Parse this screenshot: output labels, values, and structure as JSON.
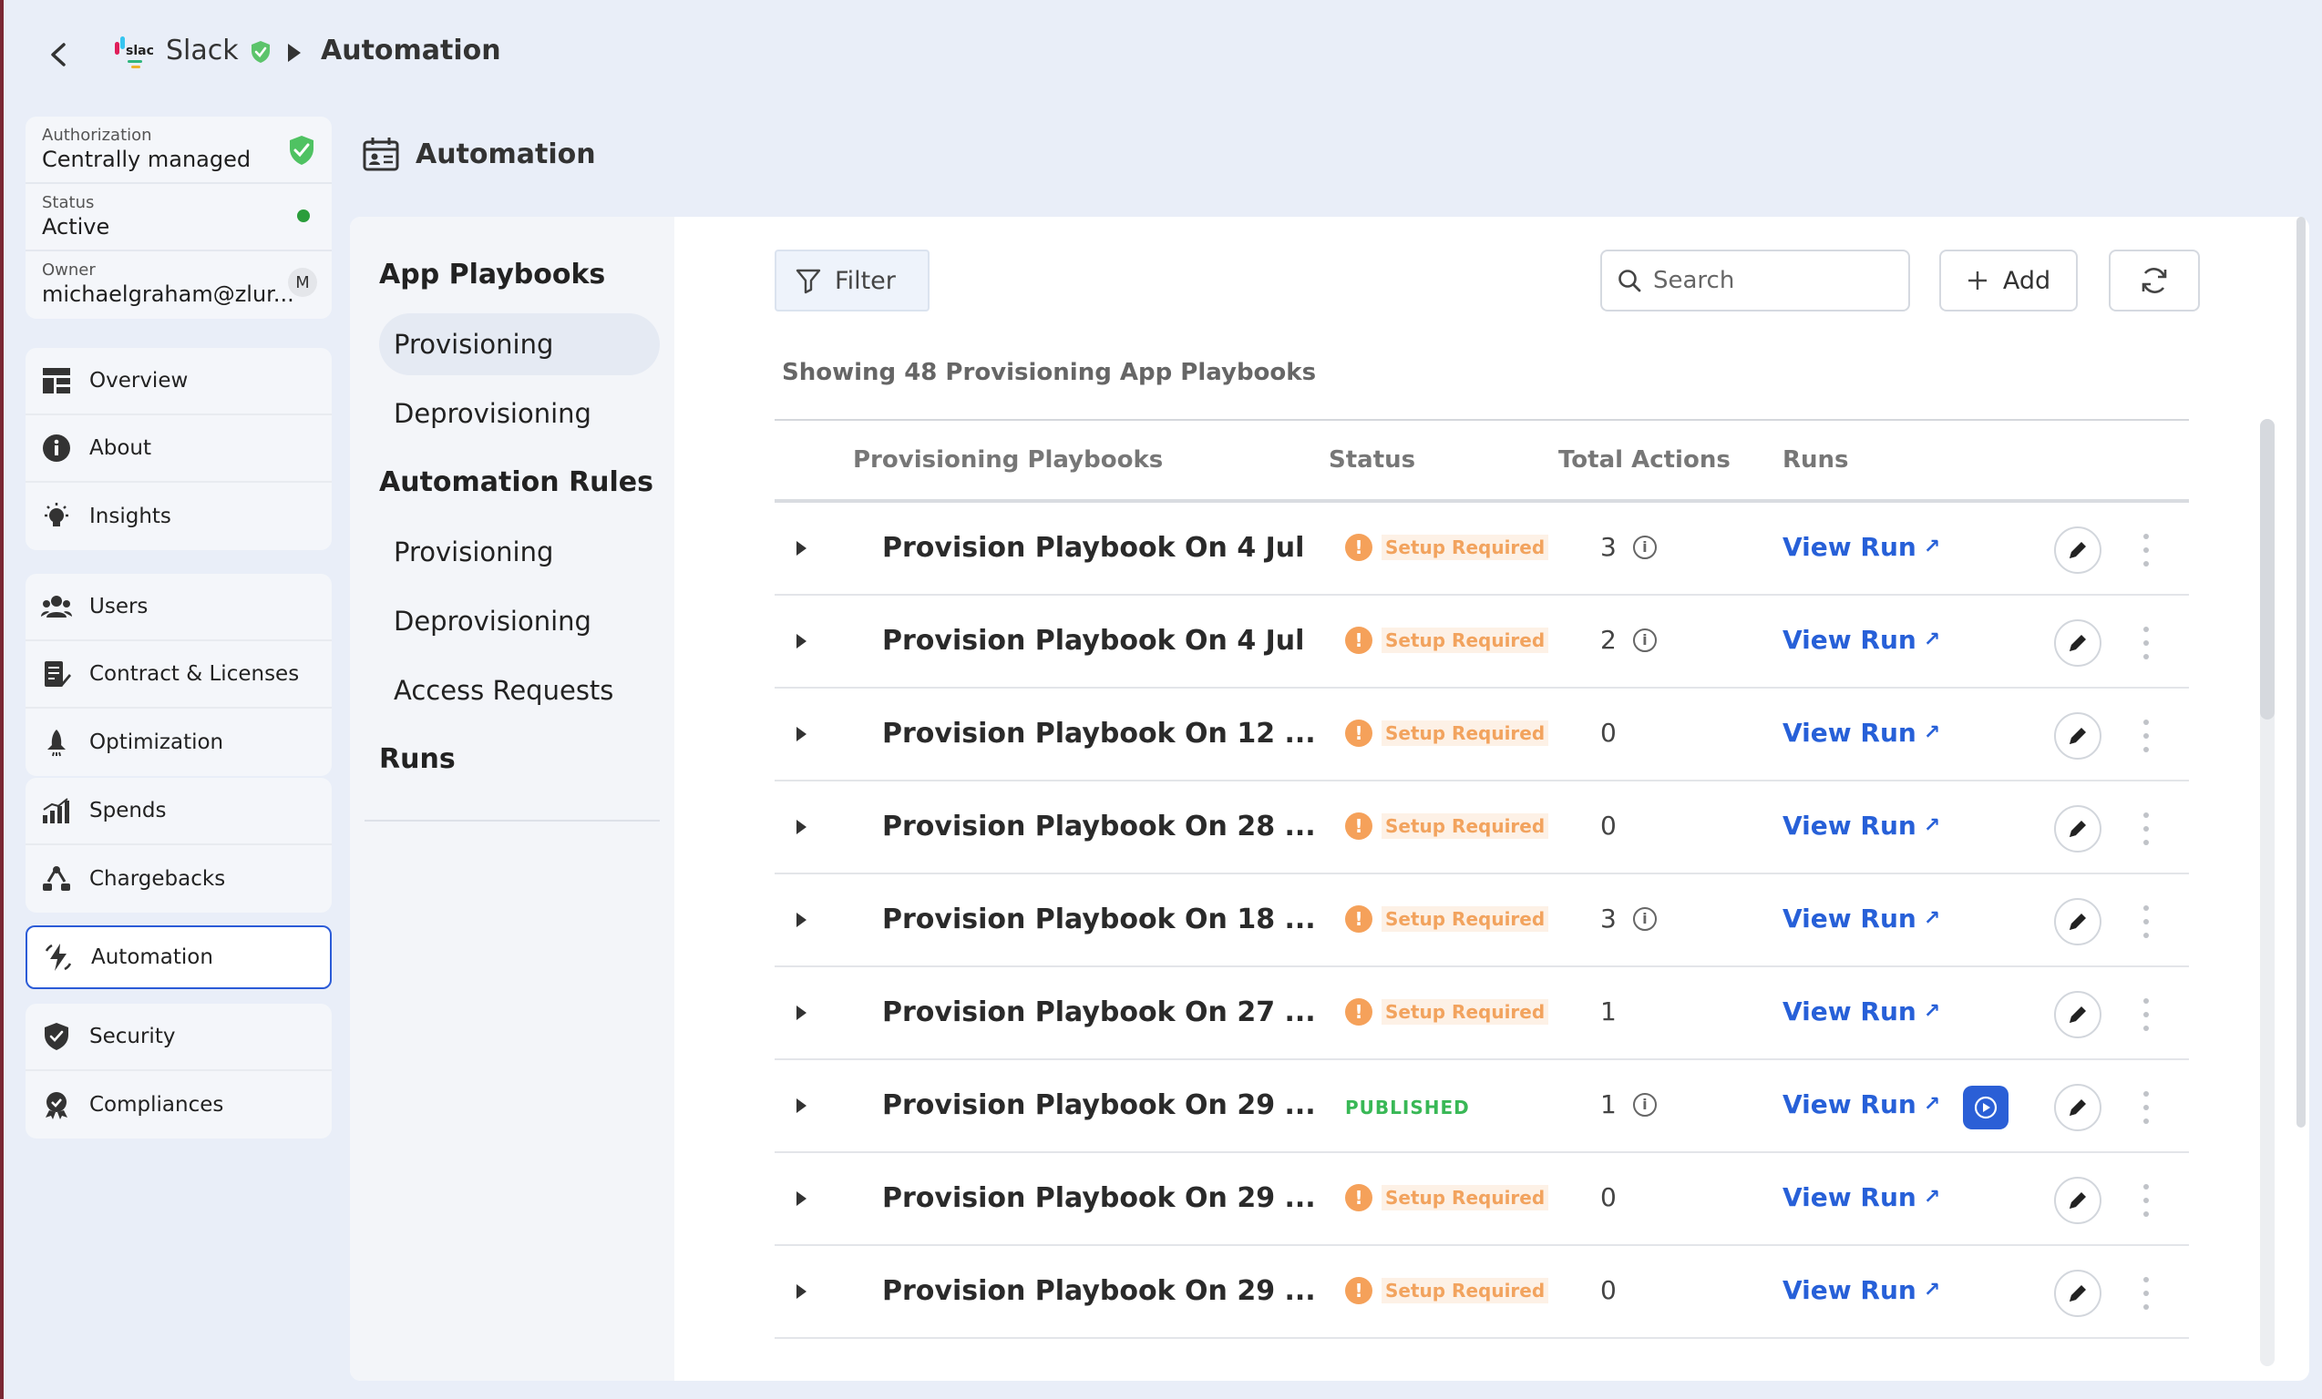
{
  "topbar": {
    "app_name": "Slack",
    "breadcrumb_current": "Automation"
  },
  "info": {
    "authorization_label": "Authorization",
    "authorization_value": "Centrally managed",
    "status_label": "Status",
    "status_value": "Active",
    "owner_label": "Owner",
    "owner_value": "michaelgraham@zlur...",
    "owner_initial": "M"
  },
  "nav": {
    "overview": "Overview",
    "about": "About",
    "insights": "Insights",
    "users": "Users",
    "contracts": "Contract & Licenses",
    "optimization": "Optimization",
    "spends": "Spends",
    "chargebacks": "Chargebacks",
    "automation": "Automation",
    "security": "Security",
    "compliances": "Compliances"
  },
  "page": {
    "title": "Automation"
  },
  "subnav": {
    "app_playbooks": "App Playbooks",
    "ap_provisioning": "Provisioning",
    "ap_deprovisioning": "Deprovisioning",
    "automation_rules": "Automation Rules",
    "ar_provisioning": "Provisioning",
    "ar_deprovisioning": "Deprovisioning",
    "ar_access_requests": "Access Requests",
    "runs": "Runs"
  },
  "toolbar": {
    "filter_label": "Filter",
    "search_placeholder": "Search",
    "add_label": "Add"
  },
  "summary": "Showing 48 Provisioning App Playbooks",
  "table": {
    "headers": {
      "playbooks": "Provisioning Playbooks",
      "status": "Status",
      "total_actions": "Total Actions",
      "runs": "Runs"
    },
    "view_run_label": "View Run",
    "rows": [
      {
        "name": "Provision Playbook On 4 Jul",
        "status": "Setup Required",
        "actions": "3",
        "info": true,
        "play": false
      },
      {
        "name": "Provision Playbook On 4 Jul",
        "status": "Setup Required",
        "actions": "2",
        "info": true,
        "play": false
      },
      {
        "name": "Provision Playbook On 12 ...",
        "status": "Setup Required",
        "actions": "0",
        "info": false,
        "play": false
      },
      {
        "name": "Provision Playbook On 28 ...",
        "status": "Setup Required",
        "actions": "0",
        "info": false,
        "play": false
      },
      {
        "name": "Provision Playbook On 18 ...",
        "status": "Setup Required",
        "actions": "3",
        "info": true,
        "play": false
      },
      {
        "name": "Provision Playbook On 27 ...",
        "status": "Setup Required",
        "actions": "1",
        "info": false,
        "play": false
      },
      {
        "name": "Provision Playbook On 29 ...",
        "status": "PUBLISHED",
        "actions": "1",
        "info": true,
        "play": true
      },
      {
        "name": "Provision Playbook On 29 ...",
        "status": "Setup Required",
        "actions": "0",
        "info": false,
        "play": false
      },
      {
        "name": "Provision Playbook On 29 ...",
        "status": "Setup Required",
        "actions": "0",
        "info": false,
        "play": false
      }
    ]
  },
  "colors": {
    "accent": "#2b5fd6",
    "warning": "#f5a15a",
    "published": "#39b856",
    "link": "#2760d8"
  }
}
